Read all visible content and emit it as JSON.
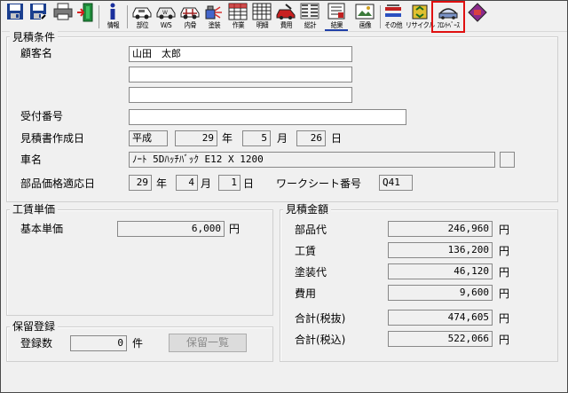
{
  "toolbar": {
    "items": [
      {
        "label": ""
      },
      {
        "label": ""
      },
      {
        "label": ""
      },
      {
        "label": ""
      },
      {
        "label": "情報"
      },
      {
        "label": "部位"
      },
      {
        "label": "W/S"
      },
      {
        "label": "内骨"
      },
      {
        "label": "塗装"
      },
      {
        "label": "作業"
      },
      {
        "label": "明細"
      },
      {
        "label": "費用"
      },
      {
        "label": "総計"
      },
      {
        "label": "結果"
      },
      {
        "label": "画像"
      },
      {
        "label": "その他"
      },
      {
        "label": "リサイクル"
      },
      {
        "label": "ﾌﾛﾝﾄﾍﾞｰｽ"
      },
      {
        "label": ""
      }
    ]
  },
  "mitsumori": {
    "title": "見積条件",
    "customer_label": "顧客名",
    "customer_name": "山田　太郎",
    "customer_line2": "",
    "customer_line3": "",
    "receipt_label": "受付番号",
    "receipt_value": "",
    "created_label": "見積書作成日",
    "era": "平成",
    "year": "29",
    "year_unit": "年",
    "month": "5",
    "month_unit": "月",
    "day": "26",
    "day_unit": "日",
    "car_label": "車名",
    "car_value": "ﾉｰﾄ 5Dﾊｯﾁﾊﾞｯｸ E12 X          1200",
    "price_date_label": "部品価格適応日",
    "p_year": "29",
    "p_year_unit": "年",
    "p_month": "4",
    "p_month_unit": "月",
    "p_day": "1",
    "p_day_unit": "日",
    "worksheet_label": "ワークシート番号",
    "worksheet_value": "Q41"
  },
  "labor": {
    "title": "工賃単価",
    "base_label": "基本単価",
    "base_value": "6,000",
    "yen": "円"
  },
  "hold": {
    "title": "保留登録",
    "count_label": "登録数",
    "count_value": "0",
    "count_unit": "件",
    "list_button": "保留一覧"
  },
  "amount": {
    "title": "見積金額",
    "yen": "円",
    "rows": [
      {
        "label": "部品代",
        "value": "246,960"
      },
      {
        "label": "工賃",
        "value": "136,200"
      },
      {
        "label": "塗装代",
        "value": "46,120"
      },
      {
        "label": "費用",
        "value": "9,600"
      },
      {
        "label": "合計(税抜)",
        "value": "474,605"
      },
      {
        "label": "合計(税込)",
        "value": "522,066"
      }
    ]
  },
  "colors": {
    "toolbar_highlight": "#e01010",
    "active_underline": "#1f3fa8"
  }
}
